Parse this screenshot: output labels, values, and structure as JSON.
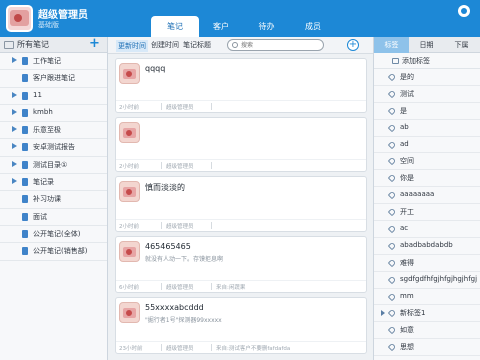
{
  "header": {
    "user_name": "超级管理员",
    "user_role": "基础版",
    "tabs": [
      "笔记",
      "客户",
      "待办",
      "成员"
    ],
    "active_tab": "笔记"
  },
  "sidebar": {
    "title": "所有笔记",
    "items": [
      {
        "label": "工作笔记",
        "expandable": true
      },
      {
        "label": "客户跟进笔记",
        "expandable": false
      },
      {
        "label": "11",
        "expandable": true
      },
      {
        "label": "kmbh",
        "expandable": true
      },
      {
        "label": "乐意至极",
        "expandable": true
      },
      {
        "label": "安卓测试报告",
        "expandable": true
      },
      {
        "label": "测试目录①",
        "expandable": true
      },
      {
        "label": "笔记录",
        "expandable": true
      },
      {
        "label": "补习功课",
        "expandable": false
      },
      {
        "label": "面试",
        "expandable": false
      },
      {
        "label": "公开笔记(全体)",
        "expandable": false
      },
      {
        "label": "公开笔记(销售部)",
        "expandable": false
      }
    ]
  },
  "notes": {
    "sort": {
      "updated": "更新时间",
      "created": "创建时间",
      "title": "笔记标题",
      "active": "updated"
    },
    "search_placeholder": "搜索",
    "items": [
      {
        "title": "qqqq",
        "body": "",
        "time": "2小时前",
        "author": "超级管理员",
        "source": ""
      },
      {
        "title": "",
        "body": "",
        "time": "2小时前",
        "author": "超级管理员",
        "source": ""
      },
      {
        "title": "慎而淡淡的",
        "body": "",
        "time": "2小时前",
        "author": "超级管理员",
        "source": ""
      },
      {
        "title": "465465465",
        "body": "就没有人动一下。存馍拒息啊",
        "time": "6小时前",
        "author": "超级管理员",
        "source": "来自:闲蔬果"
      },
      {
        "title": "55xxxxabcddd",
        "body": "\"掘行者1号\"探测器99xxxxx",
        "time": "23小时前",
        "author": "超级管理员",
        "source": "来自:测试客户不要删fafdafda"
      }
    ]
  },
  "tags": {
    "tabs": [
      "标签",
      "日期",
      "下属"
    ],
    "active_tab": "标签",
    "add_label": "添加标签",
    "items": [
      {
        "label": "是的",
        "expandable": false
      },
      {
        "label": "测试",
        "expandable": false
      },
      {
        "label": "是",
        "expandable": false
      },
      {
        "label": "ab",
        "expandable": false
      },
      {
        "label": "ad",
        "expandable": false
      },
      {
        "label": "空间",
        "expandable": false
      },
      {
        "label": "你是",
        "expandable": false
      },
      {
        "label": "aaaaaaaa",
        "expandable": false
      },
      {
        "label": "开工",
        "expandable": false
      },
      {
        "label": "ac",
        "expandable": false
      },
      {
        "label": "abadbabdabdb",
        "expandable": false
      },
      {
        "label": "难得",
        "expandable": false
      },
      {
        "label": "sgdfgdfhfgjhfgjhgjhfgj",
        "expandable": false
      },
      {
        "label": "mm",
        "expandable": false
      },
      {
        "label": "新标签1",
        "expandable": true
      },
      {
        "label": "如意",
        "expandable": false
      },
      {
        "label": "思想",
        "expandable": false
      }
    ]
  },
  "colors": {
    "header_bg": "#1d88d6",
    "accent": "#1d88d6",
    "active_tag_tab": "#8ec2ea"
  }
}
